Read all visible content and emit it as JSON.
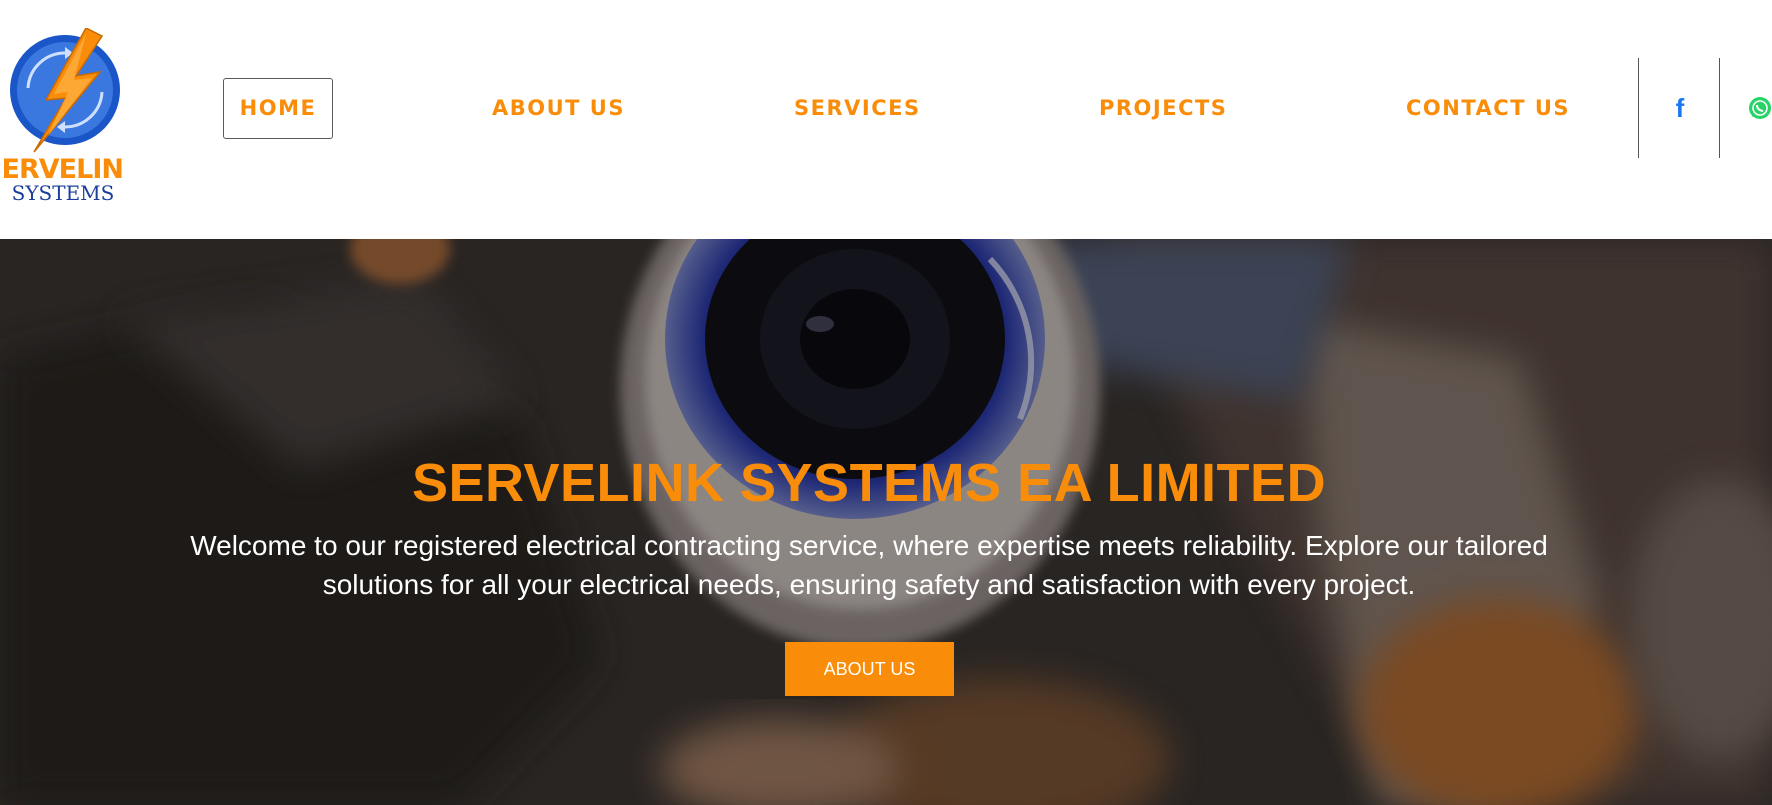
{
  "brand": {
    "logo_top": "SERVELINK",
    "logo_bottom": "SYSTEMS",
    "accent_color": "#f98d0a",
    "logo_blue": "#1a56c7"
  },
  "nav": {
    "items": [
      {
        "label": "HOME",
        "active": true
      },
      {
        "label": "ABOUT US",
        "active": false
      },
      {
        "label": "SERVICES",
        "active": false
      },
      {
        "label": "PROJECTS",
        "active": false
      },
      {
        "label": "CONTACT US",
        "active": false
      }
    ]
  },
  "social": {
    "facebook_icon": "f",
    "facebook_color": "#1877f2",
    "whatsapp_color": "#25d366"
  },
  "hero": {
    "title": "SERVELINK SYSTEMS EA LIMITED",
    "description": "Welcome to our registered electrical contracting service, where expertise meets reliability. Explore our tailored solutions for all your electrical needs, ensuring safety and satisfaction with every project.",
    "button_label": "ABOUT US"
  }
}
